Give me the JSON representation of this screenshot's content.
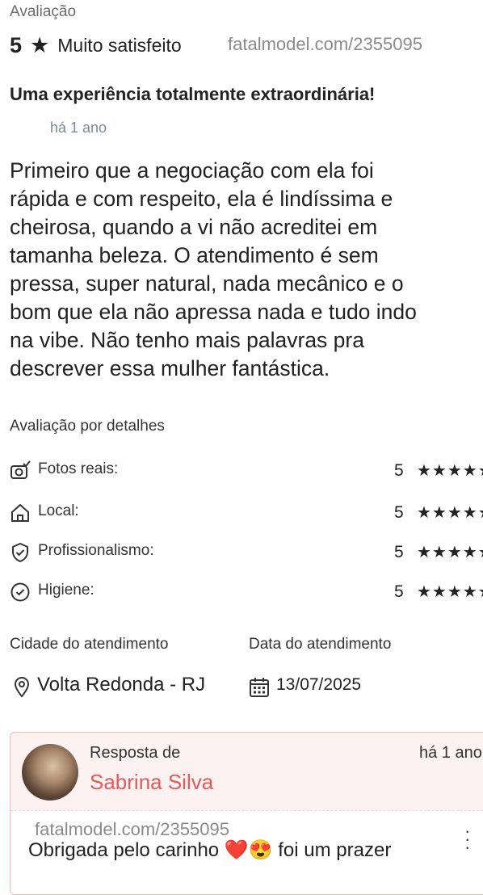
{
  "header": {
    "section_label": "Avaliação",
    "rating_value": "5",
    "rating_star": "★",
    "rating_text": "Muito satisfeito",
    "watermark": "fatalmodel.com/2355095"
  },
  "review": {
    "title": "Uma experiência totalmente extraordinária!",
    "time_ago": "há 1 ano",
    "body_lines": [
      "Primeiro que a negociação com ela foi",
      "rápida e com respeito, ela é lindíssima e",
      "cheirosa, quando a vi não acreditei em",
      "tamanha beleza. O atendimento é sem",
      "pressa, super natural, nada mecânico e o",
      "bom que ela não apressa nada e tudo indo",
      "na vibe. Não tenho mais palavras pra",
      "descrever essa mulher fantástica."
    ]
  },
  "details": {
    "title": "Avaliação por detalhes",
    "items": [
      {
        "label": "Fotos reais:",
        "score": "5",
        "stars": "★★★★★",
        "icon": "camera-check-icon"
      },
      {
        "label": "Local:",
        "score": "5",
        "stars": "★★★★★",
        "icon": "home-icon"
      },
      {
        "label": "Profissionalismo:",
        "score": "5",
        "stars": "★★★★★",
        "icon": "shield-check-icon"
      },
      {
        "label": "Higiene:",
        "score": "5",
        "stars": "★★★★★",
        "icon": "check-circle-icon"
      }
    ]
  },
  "service_info": {
    "city_label": "Cidade do atendimento",
    "city_value": "Volta Redonda - RJ",
    "date_label": "Data do atendimento",
    "date_value": "13/07/2025"
  },
  "reply": {
    "from_label": "Resposta de",
    "name": "Sabrina Silva",
    "time_ago": "há 1 ano",
    "watermark": "fatalmodel.com/2355095",
    "text": "Obrigada pelo carinho ❤️😍 foi um prazer"
  },
  "colors": {
    "accent": "#e25a5a",
    "reply_bg": "#fdf2f2",
    "reply_border": "#f0b8b8",
    "muted": "#7d8a94"
  }
}
